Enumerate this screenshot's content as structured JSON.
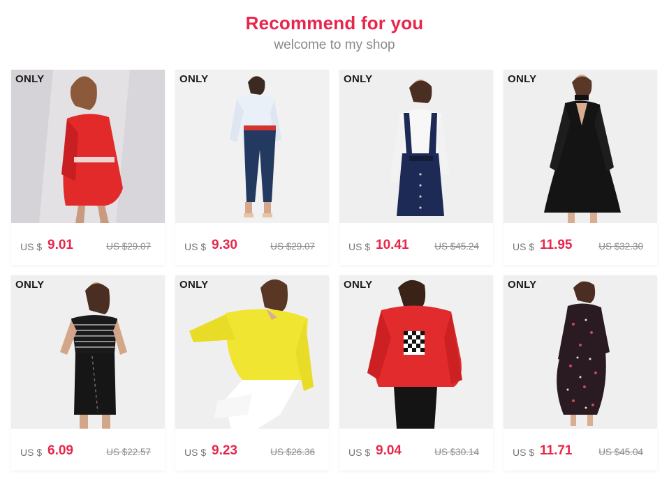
{
  "header": {
    "title": "Recommend for you",
    "subtitle": "welcome to my shop"
  },
  "currency_label": "US $",
  "products": [
    {
      "brand": "ONLY",
      "price": "9.01",
      "old_price": "US $29.07",
      "bg": "#e3e1e4",
      "garment": "#e22a2a",
      "icon": "red-off-shoulder-dress"
    },
    {
      "brand": "ONLY",
      "price": "9.30",
      "old_price": "US $29.07",
      "bg": "#f1f1f1",
      "garment": "#23395f",
      "icon": "white-blouse-jeans"
    },
    {
      "brand": "ONLY",
      "price": "10.41",
      "old_price": "US $45.24",
      "bg": "#efefef",
      "garment": "#1c2a55",
      "icon": "denim-pinafore-dress"
    },
    {
      "brand": "ONLY",
      "price": "11.95",
      "old_price": "US $32.30",
      "bg": "#efefef",
      "garment": "#141414",
      "icon": "black-knit-dress"
    },
    {
      "brand": "ONLY",
      "price": "6.09",
      "old_price": "US $22.57",
      "bg": "#efefef",
      "garment": "#1a1a1a",
      "icon": "striped-top-skirt"
    },
    {
      "brand": "ONLY",
      "price": "9.23",
      "old_price": "US $26.36",
      "bg": "#efefef",
      "garment": "#f0e530",
      "icon": "yellow-knit-sweater"
    },
    {
      "brand": "ONLY",
      "price": "9.04",
      "old_price": "US $30.14",
      "bg": "#f0f0f0",
      "garment": "#e12b2c",
      "icon": "red-hoodie-sweater"
    },
    {
      "brand": "ONLY",
      "price": "11.71",
      "old_price": "US $45.04",
      "bg": "#efefef",
      "garment": "#2a1a22",
      "icon": "floral-maxi-dress"
    }
  ]
}
